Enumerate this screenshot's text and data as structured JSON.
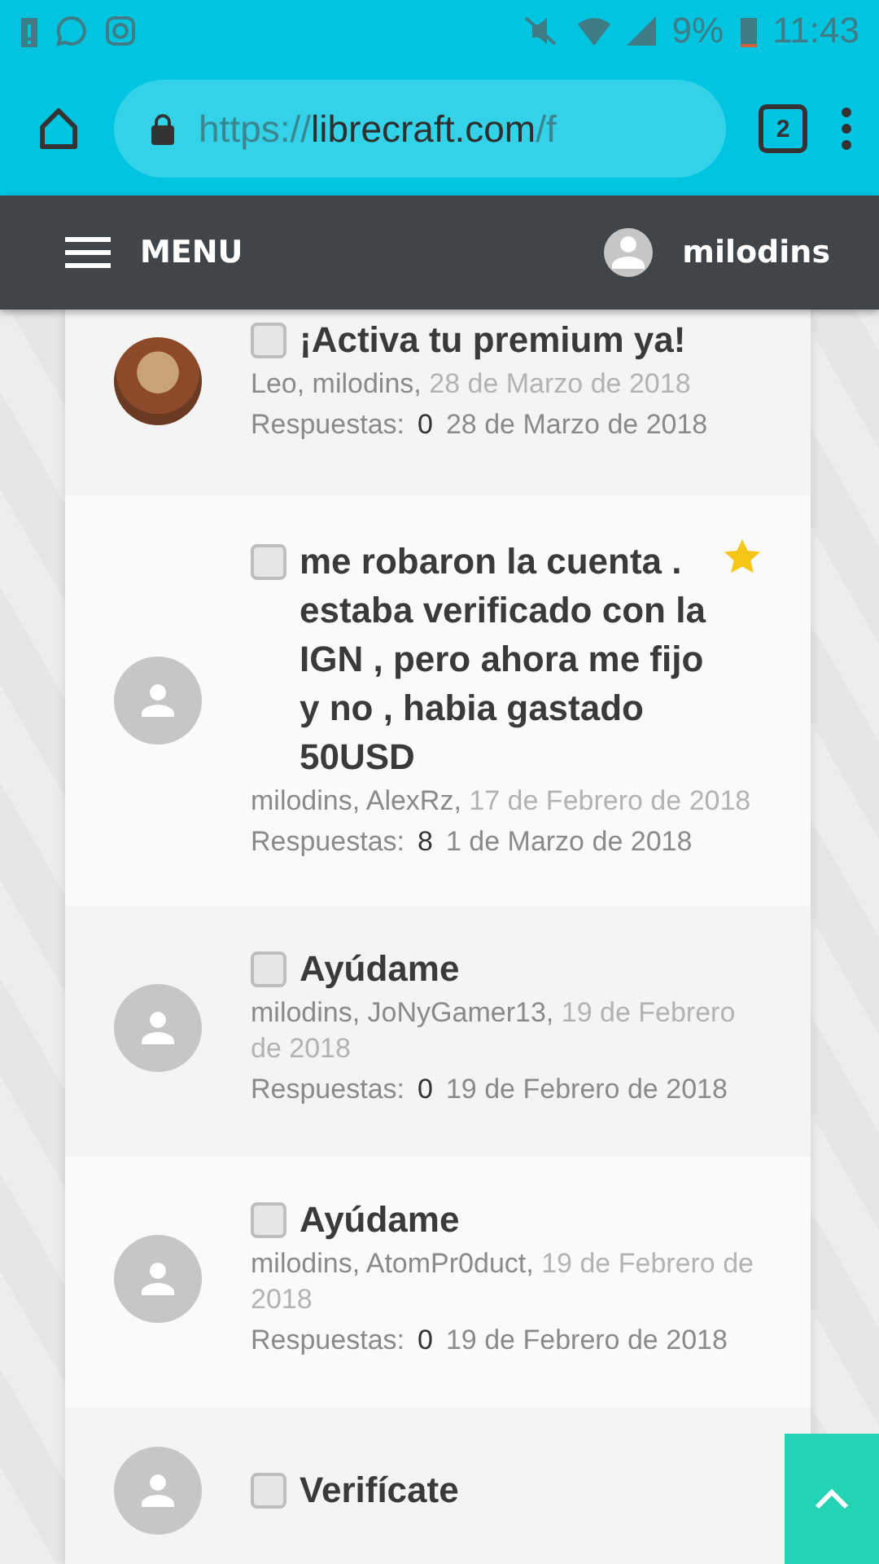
{
  "status_bar": {
    "battery": "9%",
    "time": "11:43"
  },
  "browser": {
    "url_scheme": "https://",
    "url_host": "librecraft.com",
    "url_rest": "/f",
    "tab_count": "2"
  },
  "nav": {
    "menu_label": "MENU",
    "username": "milodins"
  },
  "topics": [
    {
      "kind": "photo",
      "checked": false,
      "starred": false,
      "title": "¡Activa tu premium ya!",
      "participants": "Leo, milodins,",
      "date": "28 de Marzo de 2018",
      "replies_label": "Respuestas:",
      "replies": "0",
      "last_date": "28 de Marzo de 2018"
    },
    {
      "kind": "default",
      "checked": false,
      "starred": true,
      "title": "me robaron la cuenta . estaba verificado con la IGN , pero ahora me fijo y no , habia gastado 50USD",
      "participants": "milodins, AlexRz,",
      "date": "17 de Febrero de 2018",
      "replies_label": "Respuestas:",
      "replies": "8",
      "last_date": "1 de Marzo de 2018"
    },
    {
      "kind": "default",
      "checked": false,
      "starred": false,
      "title": "Ayúdame",
      "participants": "milodins, JoNyGamer13,",
      "date": "19 de Febrero de 2018",
      "replies_label": "Respuestas:",
      "replies": "0",
      "last_date": "19 de Febrero de 2018"
    },
    {
      "kind": "default",
      "checked": false,
      "starred": false,
      "title": "Ayúdame",
      "participants": "milodins, AtomPr0duct,",
      "date": "19 de Febrero de 2018",
      "replies_label": "Respuestas:",
      "replies": "0",
      "last_date": "19 de Febrero de 2018"
    },
    {
      "kind": "default",
      "checked": false,
      "starred": false,
      "title": "Verifícate"
    }
  ]
}
